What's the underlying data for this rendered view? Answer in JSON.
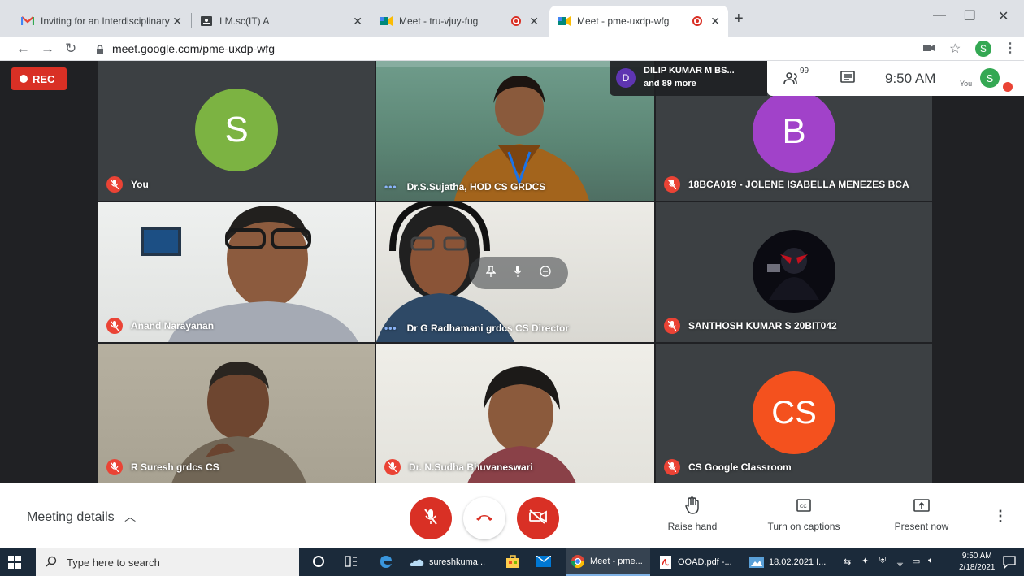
{
  "browser": {
    "tabs": [
      {
        "title": "Inviting for an Interdisciplinary R",
        "icon": "gmail-icon"
      },
      {
        "title": "I M.sc(IT) A",
        "icon": "classroom-icon"
      },
      {
        "title": "Meet - tru-vjuy-fug",
        "icon": "meet-icon",
        "recording": true
      },
      {
        "title": "Meet - pme-uxdp-wfg",
        "icon": "meet-icon",
        "recording": true,
        "active": true
      }
    ],
    "url": "meet.google.com/pme-uxdp-wfg",
    "profile_initial": "S"
  },
  "meet": {
    "rec_label": "REC",
    "presenter_initial": "D",
    "presenter_name": "DILIP KUMAR M BS...",
    "presenter_more": "and 89 more",
    "people_count": "99",
    "time": "9:50 AM",
    "you_label": "You",
    "you_initial": "S",
    "tiles": [
      {
        "name": "You",
        "type": "avatar",
        "initial": "S",
        "color": "#7cb342",
        "muted": true
      },
      {
        "name": "Dr.S.Sujatha, HOD CS GRDCS",
        "type": "video",
        "muted": false
      },
      {
        "name": "18BCA019 - JOLENE ISABELLA MENEZES BCA",
        "type": "avatar",
        "initial": "B",
        "color": "#a142c9",
        "muted": true
      },
      {
        "name": "Anand Narayanan",
        "type": "video",
        "muted": true
      },
      {
        "name": "Dr G Radhamani grdcs CS Director",
        "type": "video",
        "muted": false
      },
      {
        "name": "SANTHOSH KUMAR S 20BIT042",
        "type": "photo",
        "muted": true
      },
      {
        "name": "R Suresh grdcs CS",
        "type": "video",
        "muted": true
      },
      {
        "name": "Dr. N.Sudha Bhuvaneswari",
        "type": "video",
        "muted": true
      },
      {
        "name": "CS Google Classroom",
        "type": "avatar",
        "initial": "CS",
        "color": "#f4511e",
        "muted": true
      }
    ],
    "bottom": {
      "meeting_details": "Meeting details",
      "raise_hand": "Raise hand",
      "captions": "Turn on captions",
      "present": "Present now"
    }
  },
  "taskbar": {
    "search_placeholder": "Type here to search",
    "items": [
      {
        "label": "sureshkuma...",
        "icon": "onedrive-icon"
      },
      {
        "label": "Meet - pme...",
        "icon": "chrome-icon"
      },
      {
        "label": "OOAD.pdf -...",
        "icon": "pdf-icon"
      },
      {
        "label": "18.02.2021 I...",
        "icon": "image-icon"
      }
    ],
    "clock_time": "9:50 AM",
    "clock_date": "2/18/2021"
  },
  "colors": {
    "meet_red": "#d93025",
    "stage_bg": "#202124"
  }
}
